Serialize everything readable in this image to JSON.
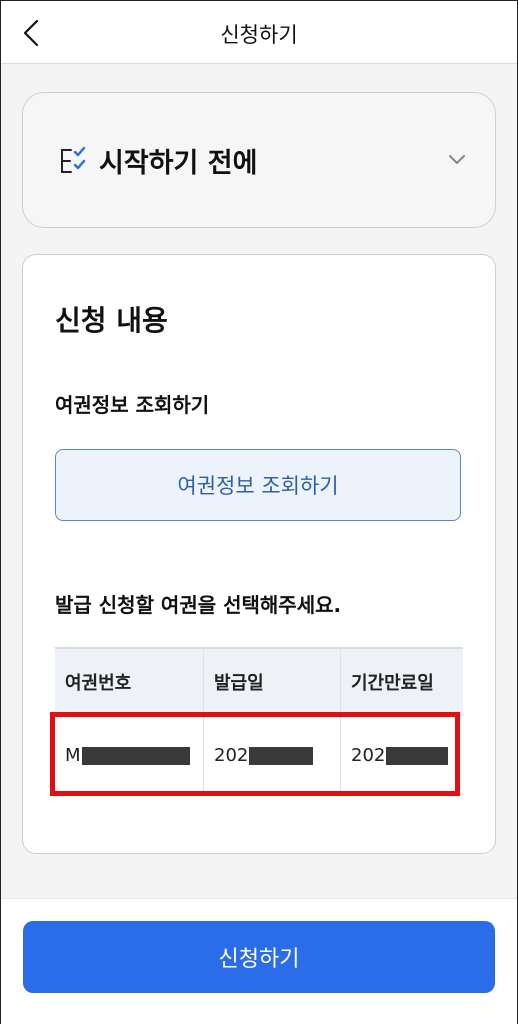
{
  "header": {
    "title": "신청하기"
  },
  "before_section": {
    "title": "시작하기 전에"
  },
  "apply_section": {
    "title": "신청 내용",
    "passport_lookup_label": "여권정보 조회하기",
    "passport_lookup_button": "여권정보 조회하기",
    "select_label": "발급 신청할 여권을 선택해주세요.",
    "table": {
      "columns": [
        "여권번호",
        "발급일",
        "기간만료일"
      ],
      "rows": [
        {
          "passport_number": "M",
          "issue_date": "202",
          "expiry_date": "202"
        }
      ]
    }
  },
  "footer": {
    "apply_button": "신청하기"
  },
  "colors": {
    "primary": "#2b6de8",
    "outline_button": "#5b86c6",
    "highlight": "#e01010"
  }
}
